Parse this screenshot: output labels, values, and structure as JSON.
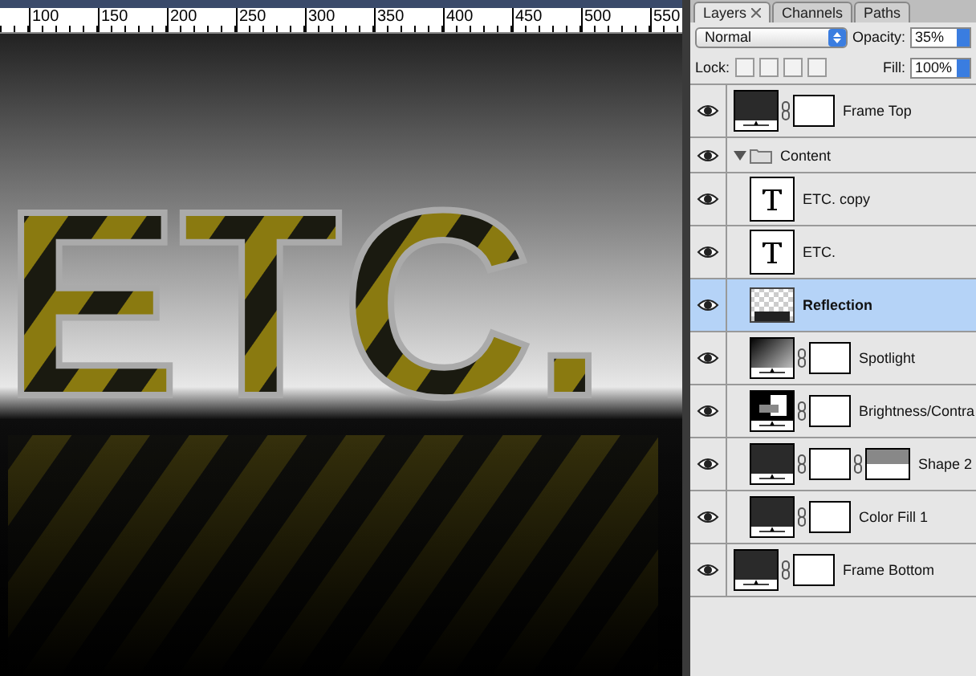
{
  "ruler": {
    "ticks": [
      "100",
      "150",
      "200",
      "250",
      "300",
      "350",
      "400",
      "450",
      "500",
      "550"
    ]
  },
  "canvas": {
    "artwork_text": "ETC."
  },
  "layers_panel": {
    "tabs": [
      {
        "label": "Layers",
        "selected": true,
        "closable": true
      },
      {
        "label": "Channels",
        "selected": false,
        "closable": false
      },
      {
        "label": "Paths",
        "selected": false,
        "closable": false
      }
    ],
    "blend_mode": "Normal",
    "opacity_label": "Opacity:",
    "opacity": "35%",
    "lock_label": "Lock:",
    "fill_label": "Fill:",
    "fill": "100%",
    "layers": [
      {
        "name": "Frame Top",
        "kind": "fill",
        "mask": true,
        "vector_mask": false,
        "visible": true,
        "selected": false
      },
      {
        "name": "Content",
        "kind": "group",
        "expanded": true,
        "visible": true,
        "selected": false,
        "children": [
          {
            "name": "ETC. copy",
            "kind": "text",
            "mask": false,
            "vector_mask": false,
            "visible": true,
            "selected": false
          },
          {
            "name": "ETC.",
            "kind": "text",
            "mask": false,
            "vector_mask": false,
            "visible": true,
            "selected": false
          },
          {
            "name": "Reflection",
            "kind": "image",
            "mask": false,
            "vector_mask": false,
            "visible": true,
            "selected": true
          },
          {
            "name": "Spotlight",
            "kind": "gradient",
            "mask": true,
            "vector_mask": false,
            "visible": true,
            "selected": false
          },
          {
            "name": "Brightness/Contra",
            "kind": "adjustment",
            "mask": true,
            "vector_mask": false,
            "visible": true,
            "selected": false
          },
          {
            "name": "Shape 2",
            "kind": "fill",
            "mask": true,
            "vector_mask": true,
            "visible": true,
            "selected": false
          },
          {
            "name": "Color Fill 1",
            "kind": "fill",
            "mask": true,
            "vector_mask": false,
            "visible": true,
            "selected": false
          }
        ]
      },
      {
        "name": "Frame Bottom",
        "kind": "fill",
        "mask": true,
        "vector_mask": false,
        "visible": true,
        "selected": false
      }
    ]
  }
}
